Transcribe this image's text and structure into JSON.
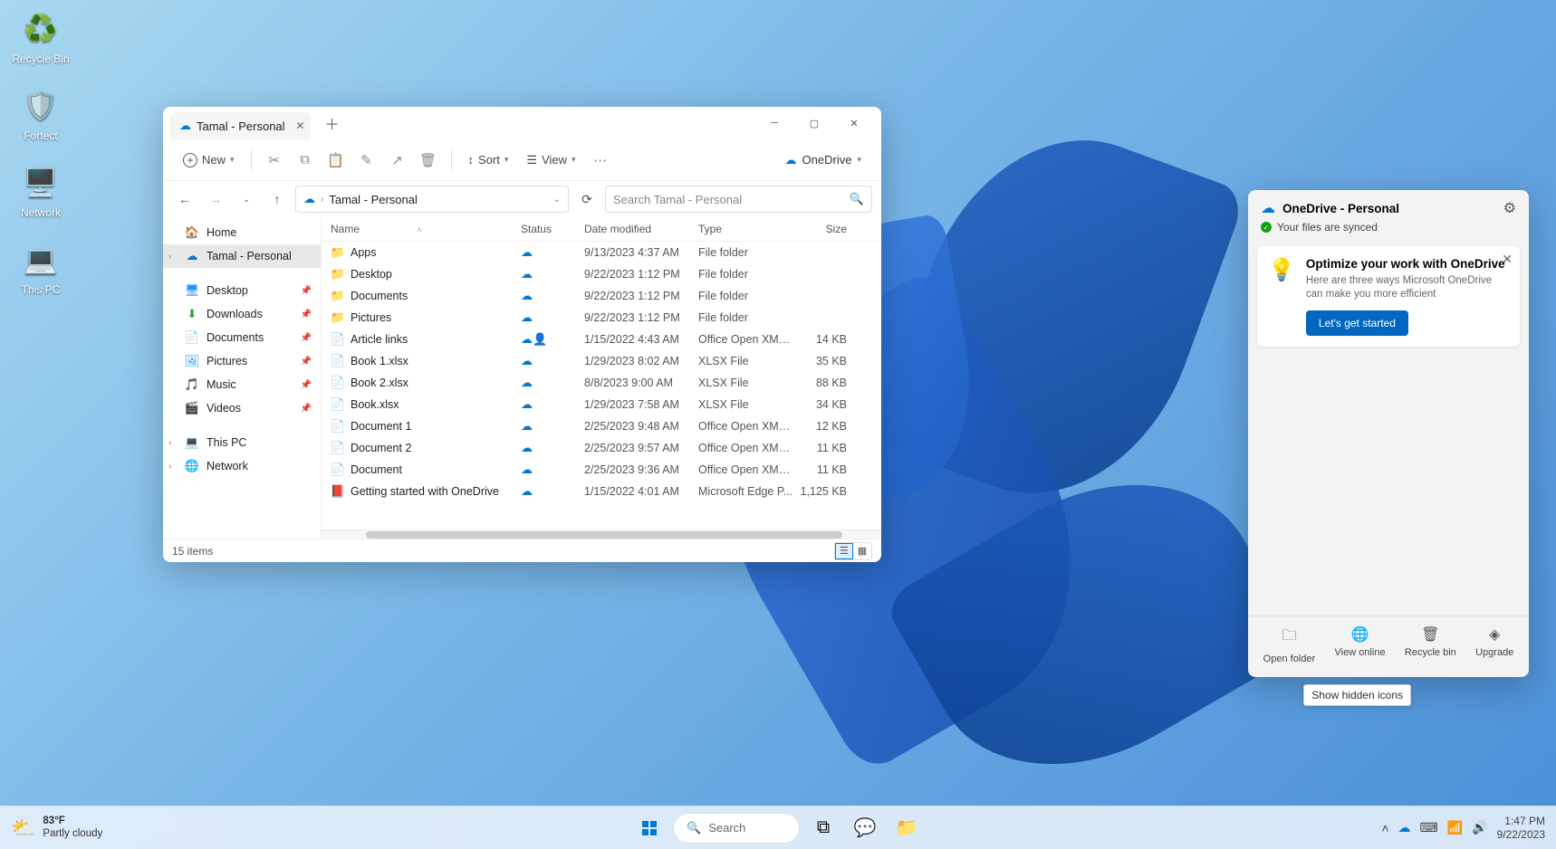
{
  "desktop": {
    "icons": [
      {
        "label": "Recycle Bin",
        "glyph": "🗑"
      },
      {
        "label": "Fortect",
        "glyph": "🛡"
      },
      {
        "label": "Network",
        "glyph": "🖥"
      },
      {
        "label": "This PC",
        "glyph": "💻"
      }
    ]
  },
  "explorer": {
    "tab_title": "Tamal - Personal",
    "toolbar": {
      "new_label": "New",
      "sort_label": "Sort",
      "view_label": "View",
      "onedrive_label": "OneDrive"
    },
    "address": {
      "crumb": "Tamal - Personal"
    },
    "search_placeholder": "Search Tamal - Personal",
    "columns": {
      "name": "Name",
      "status": "Status",
      "date": "Date modified",
      "type": "Type",
      "size": "Size"
    },
    "sidebar": {
      "home": "Home",
      "tamal": "Tamal - Personal",
      "desktop": "Desktop",
      "downloads": "Downloads",
      "documents": "Documents",
      "pictures": "Pictures",
      "music": "Music",
      "videos": "Videos",
      "thispc": "This PC",
      "network": "Network"
    },
    "files": [
      {
        "ico": "📁",
        "name": "Apps",
        "status": "☁",
        "date": "9/13/2023 4:37 AM",
        "type": "File folder",
        "size": ""
      },
      {
        "ico": "📁",
        "name": "Desktop",
        "status": "☁",
        "date": "9/22/2023 1:12 PM",
        "type": "File folder",
        "size": ""
      },
      {
        "ico": "📁",
        "name": "Documents",
        "status": "☁",
        "date": "9/22/2023 1:12 PM",
        "type": "File folder",
        "size": ""
      },
      {
        "ico": "📁",
        "name": "Pictures",
        "status": "☁",
        "date": "9/22/2023 1:12 PM",
        "type": "File folder",
        "size": ""
      },
      {
        "ico": "📄",
        "name": "Article links",
        "status": "☁👤",
        "date": "1/15/2022 4:43 AM",
        "type": "Office Open XML ...",
        "size": "14 KB"
      },
      {
        "ico": "📄",
        "name": "Book 1.xlsx",
        "status": "☁",
        "date": "1/29/2023 8:02 AM",
        "type": "XLSX File",
        "size": "35 KB"
      },
      {
        "ico": "📄",
        "name": "Book 2.xlsx",
        "status": "☁",
        "date": "8/8/2023 9:00 AM",
        "type": "XLSX File",
        "size": "88 KB"
      },
      {
        "ico": "📄",
        "name": "Book.xlsx",
        "status": "☁",
        "date": "1/29/2023 7:58 AM",
        "type": "XLSX File",
        "size": "34 KB"
      },
      {
        "ico": "📄",
        "name": "Document 1",
        "status": "☁",
        "date": "2/25/2023 9:48 AM",
        "type": "Office Open XML ...",
        "size": "12 KB"
      },
      {
        "ico": "📄",
        "name": "Document 2",
        "status": "☁",
        "date": "2/25/2023 9:57 AM",
        "type": "Office Open XML ...",
        "size": "11 KB"
      },
      {
        "ico": "📄",
        "name": "Document",
        "status": "☁",
        "date": "2/25/2023 9:36 AM",
        "type": "Office Open XML ...",
        "size": "11 KB"
      },
      {
        "ico": "📕",
        "name": "Getting started with OneDrive",
        "status": "☁",
        "date": "1/15/2022 4:01 AM",
        "type": "Microsoft Edge P...",
        "size": "1,125 KB"
      }
    ],
    "status_text": "15 items"
  },
  "onedrive": {
    "title": "OneDrive - Personal",
    "sync_text": "Your files are synced",
    "card": {
      "title": "Optimize your work with OneDrive",
      "body": "Here are three ways Microsoft OneDrive can make you more efficient",
      "cta": "Let's get started"
    },
    "actions": {
      "open": "Open folder",
      "view": "View online",
      "recycle": "Recycle bin",
      "upgrade": "Upgrade"
    }
  },
  "tooltip": "Show hidden icons",
  "taskbar": {
    "weather_temp": "83°F",
    "weather_cond": "Partly cloudy",
    "search": "Search",
    "time": "1:47 PM",
    "date": "9/22/2023"
  }
}
